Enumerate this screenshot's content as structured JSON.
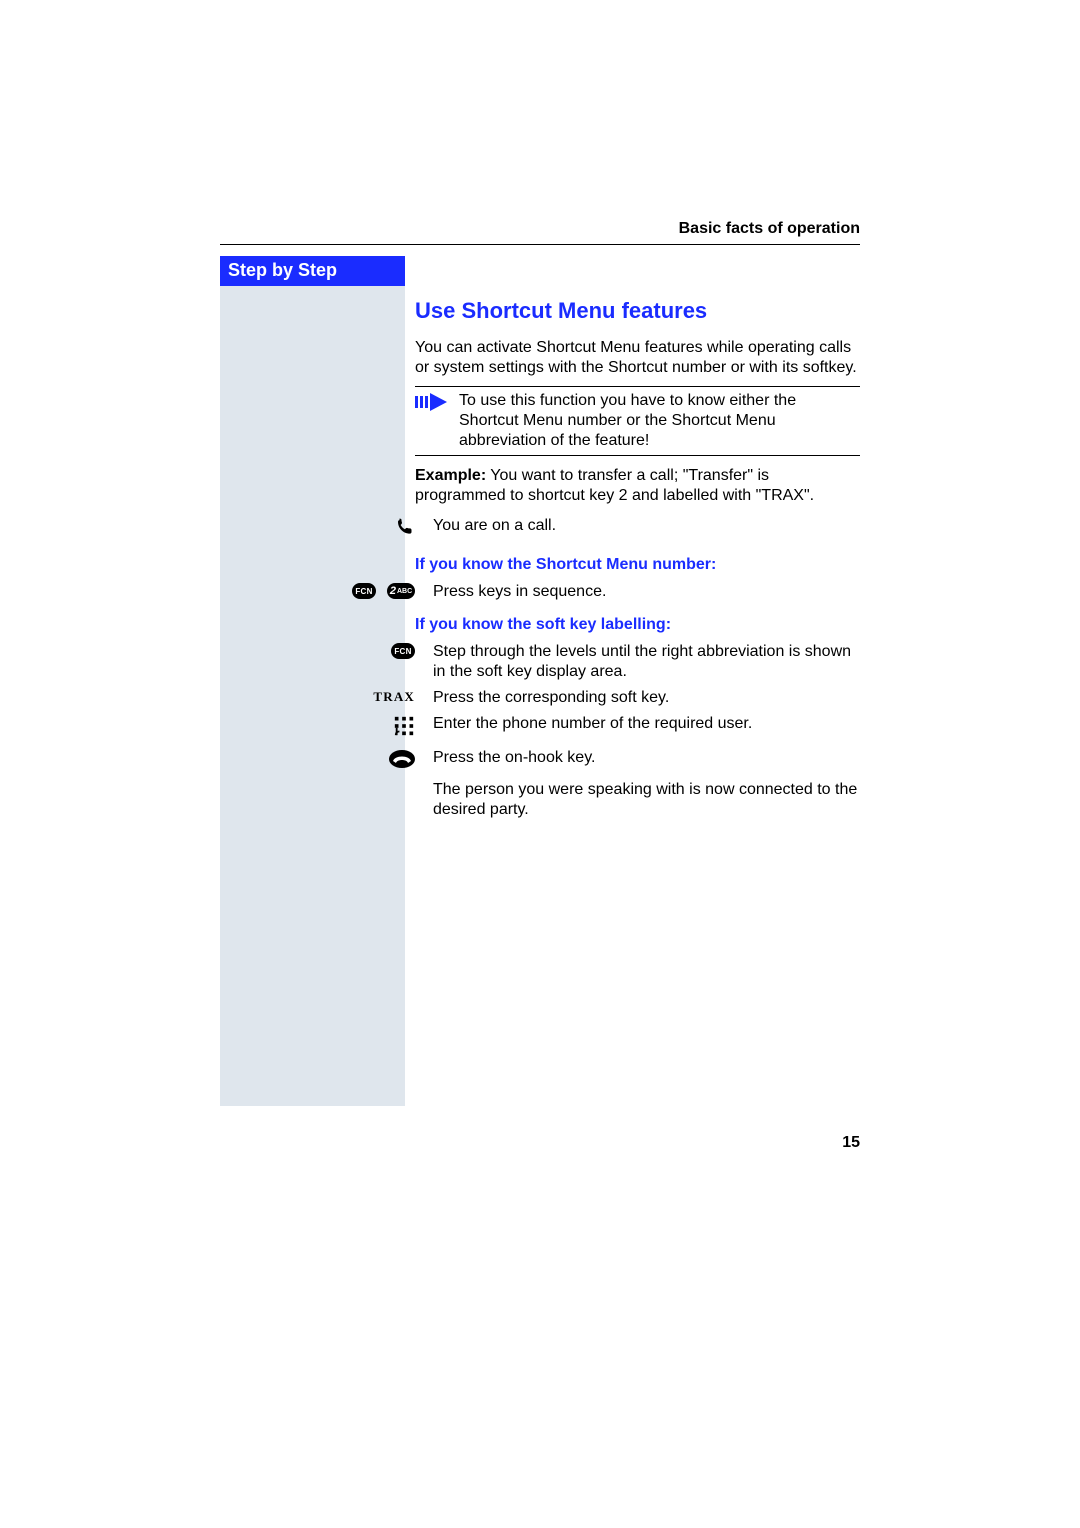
{
  "running_head": "Basic facts of operation",
  "sidebar": {
    "title": "Step by Step"
  },
  "content": {
    "h2": "Use Shortcut Menu features",
    "intro": "You can activate Shortcut Menu features while operating calls or system settings with the Shortcut number or with its softkey.",
    "note": "To use this function you have to know either the Shortcut Menu number or the Shortcut Menu abbreviation of the feature!",
    "example_label": "Example:",
    "example_text": " You want to transfer a call; \"Transfer\" is programmed to shortcut key 2 and labelled with \"TRAX\".",
    "on_call": "You are on a call.",
    "subhead1": "If you know the Shortcut Menu number:",
    "press_keys": "Press keys in sequence.",
    "subhead2": "If you know the soft key labelling:",
    "step_through": "Step through the levels until the right abbreviation is shown in the soft key display area.",
    "press_softkey": "Press the corresponding soft key.",
    "enter_number": "Enter the phone number of the required user.",
    "press_onhook": "Press the on-hook key.",
    "connected": "The person you were speaking with is now connected to the desired party.",
    "fcn_label": "FCN",
    "two_digit": "2",
    "abc": "ABC",
    "trax": "TRAX"
  },
  "page_number": "15"
}
